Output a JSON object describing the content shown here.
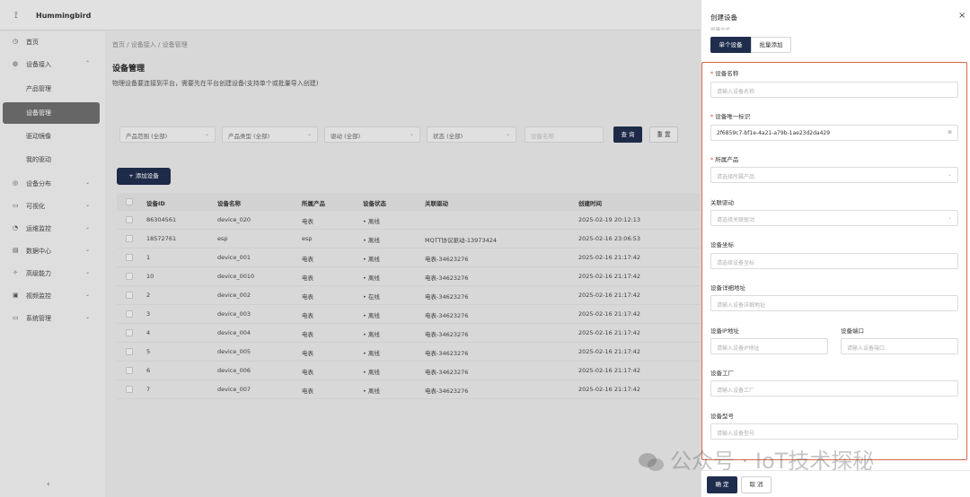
{
  "app": {
    "name": "Hummingbird"
  },
  "sidebar": {
    "items": [
      {
        "label": "首页",
        "icon": "clock-icon"
      },
      {
        "label": "设备接入",
        "icon": "globe-icon",
        "chev": "⌃"
      },
      {
        "label": "产品管理",
        "sub": true
      },
      {
        "label": "设备管理",
        "sub": true,
        "active": true
      },
      {
        "label": "驱动镜像",
        "sub": true
      },
      {
        "label": "我的驱动",
        "sub": true
      },
      {
        "label": "设备分布",
        "icon": "location-icon",
        "chev": "⌄"
      },
      {
        "label": "可视化",
        "icon": "monitor-icon",
        "chev": "⌄"
      },
      {
        "label": "运维监控",
        "icon": "gauge-icon",
        "chev": "⌄"
      },
      {
        "label": "数据中心",
        "icon": "database-icon",
        "chev": "⌄"
      },
      {
        "label": "高级能力",
        "icon": "ai-icon",
        "chev": "⌄"
      },
      {
        "label": "视频监控",
        "icon": "video-icon",
        "chev": "⌄"
      },
      {
        "label": "系统管理",
        "icon": "settings-icon",
        "chev": "⌄"
      }
    ],
    "collapse": "‹"
  },
  "main": {
    "breadcrumb": "首页 / 设备接入 / 设备管理",
    "title": "设备管理",
    "description": "物理设备要连接到平台，需要先在平台创建设备(支持单个或批量导入创建)",
    "filters": {
      "product_range": "产品范围 (全部)",
      "product_type": "产品类型 (全部)",
      "driver": "驱动 (全部)",
      "status": "状态 (全部)",
      "name_placeholder": "设备名称",
      "query": "查 询",
      "reset": "重 置"
    },
    "add_button": "+ 添加设备",
    "table": {
      "columns": [
        "设备ID",
        "设备名称",
        "所属产品",
        "设备状态",
        "关联驱动",
        "创建时间"
      ],
      "rows": [
        [
          "86304561",
          "device_020",
          "电表",
          "• 离线",
          "",
          "2025-02-19 20:12:13"
        ],
        [
          "18572761",
          "esp",
          "esp",
          "• 离线",
          "MQTT协议驱动-13973424",
          "2025-02-16 23:06:53"
        ],
        [
          "1",
          "device_001",
          "电表",
          "• 离线",
          "电表-34623276",
          "2025-02-16 21:17:42"
        ],
        [
          "10",
          "device_0010",
          "电表",
          "• 离线",
          "电表-34623276",
          "2025-02-16 21:17:42"
        ],
        [
          "2",
          "device_002",
          "电表",
          "• 在线",
          "电表-34623276",
          "2025-02-16 21:17:42"
        ],
        [
          "3",
          "device_003",
          "电表",
          "• 离线",
          "电表-34623276",
          "2025-02-16 21:17:42"
        ],
        [
          "4",
          "device_004",
          "电表",
          "• 离线",
          "电表-34623276",
          "2025-02-16 21:17:42"
        ],
        [
          "5",
          "device_005",
          "电表",
          "• 离线",
          "电表-34623276",
          "2025-02-16 21:17:42"
        ],
        [
          "6",
          "device_006",
          "电表",
          "• 离线",
          "电表-34623276",
          "2025-02-16 21:17:42"
        ],
        [
          "7",
          "device_007",
          "电表",
          "• 离线",
          "电表-34623276",
          "2025-02-16 21:17:42"
        ]
      ]
    }
  },
  "drawer": {
    "title": "创建设备",
    "close": "×",
    "cut_label": "创建方式",
    "tab_single": "单个设备",
    "tab_batch": "批量添加",
    "fields": {
      "name_label": "设备名称",
      "name_placeholder": "请输入设备名称",
      "uid_label": "设备唯一标识",
      "uid_value": "2f6859c7-bf1e-4a21-a79b-1ae23d2da429",
      "product_label": "所属产品",
      "product_placeholder": "请选择所属产品",
      "driver_label": "关联驱动",
      "driver_placeholder": "请选择关联驱动",
      "coord_label": "设备坐标",
      "coord_placeholder": "请选择设备坐标",
      "address_label": "设备详细地址",
      "address_placeholder": "请输入设备详细地址",
      "ip_label": "设备IP地址",
      "ip_placeholder": "请输入设备IP地址",
      "port_label": "设备端口",
      "port_placeholder": "请输入设备端口",
      "factory_label": "设备工厂",
      "factory_placeholder": "请输入设备工厂",
      "model_label": "设备型号",
      "model_placeholder": "请输入设备型号"
    },
    "ok": "确 定",
    "cancel": "取 消"
  },
  "watermark": "公众号 · IoT技术探秘"
}
